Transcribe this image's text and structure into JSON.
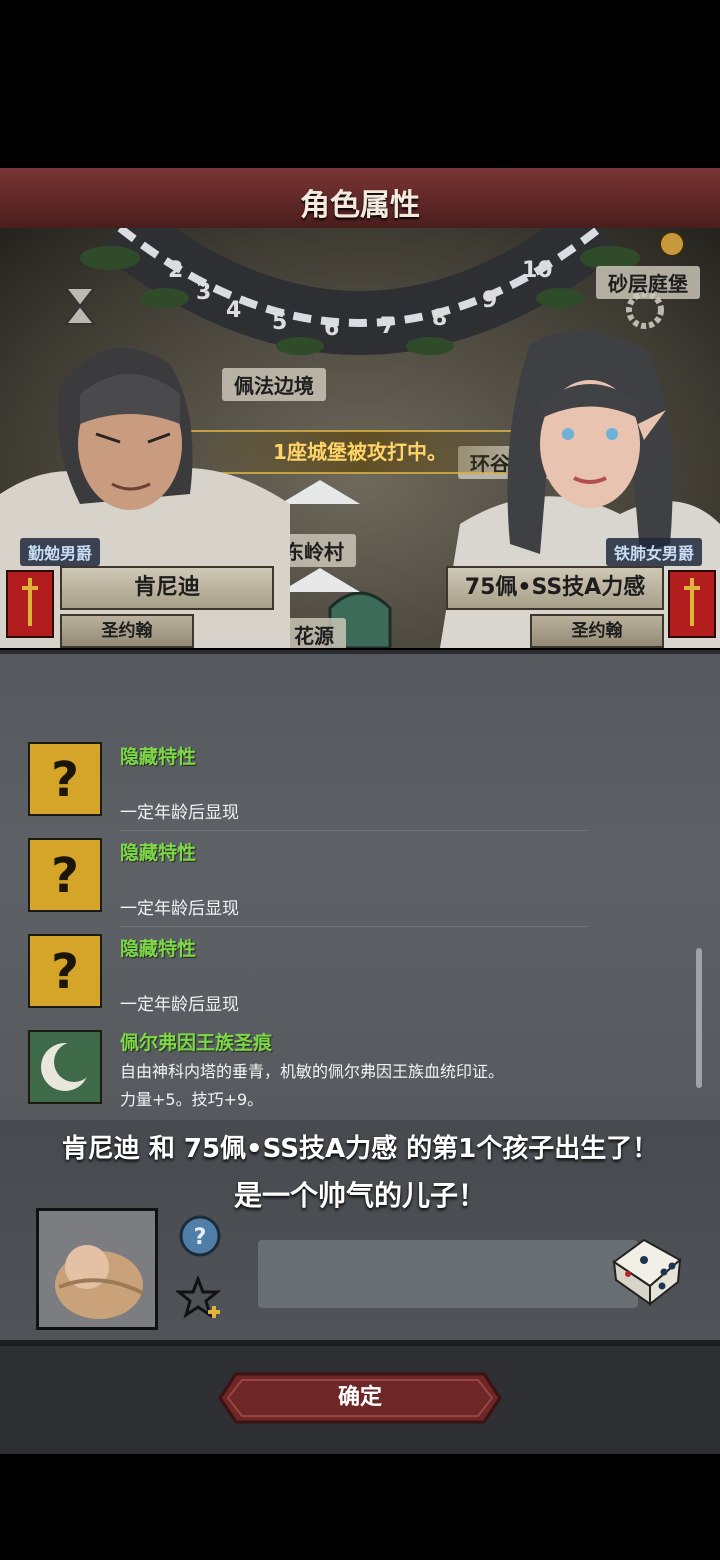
{
  "header": {
    "title": "角色属性"
  },
  "map": {
    "ring_numbers": [
      "2",
      "3",
      "4",
      "5",
      "6",
      "7",
      "8",
      "9",
      "10"
    ],
    "labels": {
      "sand": "砂层庭堡",
      "border": "佩法边境",
      "valley": "环谷要塞",
      "village": "东岭村",
      "flower": "花源"
    },
    "siege_text": "1座城堡被攻打中。"
  },
  "father": {
    "rank": "勤勉男爵",
    "name": "肯尼迪",
    "liege": "圣约翰"
  },
  "mother": {
    "rank": "铁肺女男爵",
    "name": "75佩•SS技A力感",
    "liege": "圣约翰"
  },
  "traits": [
    {
      "name": "隐藏特性",
      "desc": "一定年龄后显现",
      "icon": "question-icon"
    },
    {
      "name": "隐藏特性",
      "desc": "一定年龄后显现",
      "icon": "question-icon"
    },
    {
      "name": "隐藏特性",
      "desc": "一定年龄后显现",
      "icon": "question-icon"
    },
    {
      "name": "佩尔弗因王族圣痕",
      "desc": "自由神科内塔的垂青，机敏的佩尔弗因王族血统印证。",
      "stats": "力量+5。技巧+9。",
      "icon": "crescent-icon"
    }
  ],
  "birth": {
    "line1": "肯尼迪 和 75佩•SS技A力感 的第1个孩子出生了！",
    "line2": "是一个帅气的儿子！"
  },
  "buttons": {
    "confirm": "确定"
  },
  "colors": {
    "header": "#6b2e2e",
    "trait_green": "#7fd64a",
    "button_red": "#7a2b2b",
    "banner_gold": "#ffd56a"
  }
}
